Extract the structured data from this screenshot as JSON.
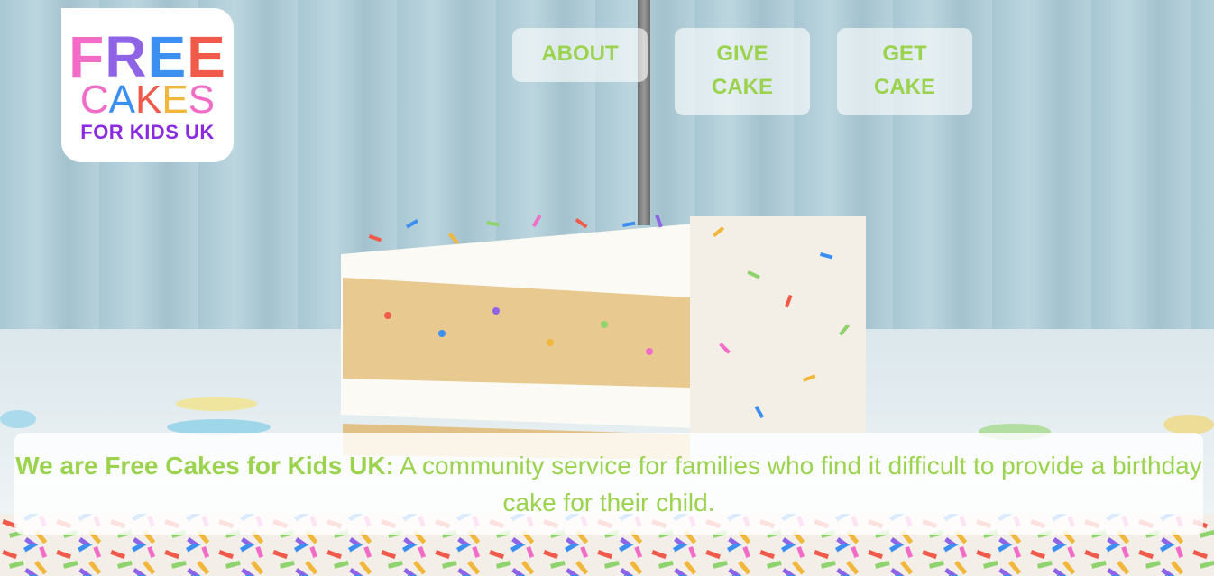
{
  "logo": {
    "line1_letters": [
      {
        "char": "F",
        "color": "#f06cc7"
      },
      {
        "char": "R",
        "color": "#8f63e6"
      },
      {
        "char": "E",
        "color": "#3b8ff0"
      },
      {
        "char": "E",
        "color": "#ef5a4b"
      }
    ],
    "line2_letters": [
      {
        "char": "C",
        "color": "#f06cc7"
      },
      {
        "char": "A",
        "color": "#3b8ff0"
      },
      {
        "char": "K",
        "color": "#ef5a4b"
      },
      {
        "char": "E",
        "color": "#f0b73a"
      },
      {
        "char": "S",
        "color": "#f06cc7"
      }
    ],
    "line3": "FOR KIDS UK"
  },
  "nav": {
    "about": "ABOUT",
    "give_line1": "GIVE",
    "give_line2": "CAKE",
    "get_line1": "GET",
    "get_line2": "CAKE"
  },
  "banner": {
    "bold": "We are Free Cakes for Kids UK:",
    "text": " A community service for families who find it difficult to provide a birthday cake for their child."
  },
  "colors": {
    "accent_green": "#9bd34e",
    "hero_blue": "#a7c7d3"
  }
}
